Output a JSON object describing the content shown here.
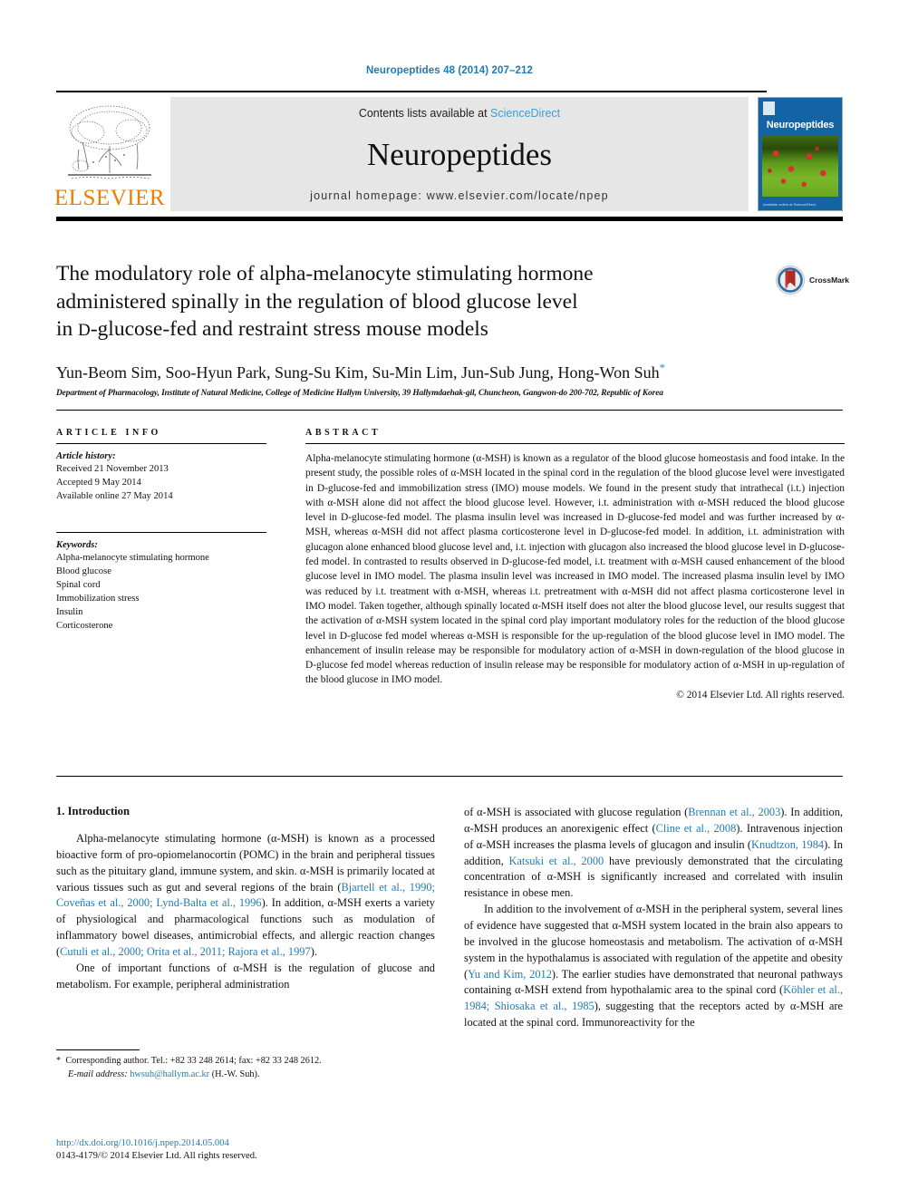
{
  "running_head": "Neuropeptides 48 (2014) 207–212",
  "masthead": {
    "contents_prefix": "Contents lists available at ",
    "sciencedirect": "ScienceDirect",
    "journal_name": "Neuropeptides",
    "homepage": "journal homepage: www.elsevier.com/locate/npep",
    "publisher_wordmark": "ELSEVIER",
    "cover_title": "Neuropeptides",
    "cover_footnote": "Available online at ScienceDirect"
  },
  "article": {
    "title_line1": "The modulatory role of alpha-melanocyte stimulating hormone",
    "title_line2": "administered spinally in the regulation of blood glucose level",
    "title_line3_a": "in ",
    "title_line3_smallcap": "D",
    "title_line3_b": "-glucose-fed and restraint stress mouse models",
    "authors": "Yun-Beom Sim, Soo-Hyun Park, Sung-Su Kim, Su-Min Lim, Jun-Sub Jung, Hong-Won Suh",
    "author_star": "*",
    "affiliation": "Department of Pharmacology, Institute of Natural Medicine, College of Medicine Hallym University, 39 Hallymdaehak-gil, Chuncheon, Gangwon-do 200-702, Republic of Korea",
    "crossmark_label": "CrossMark"
  },
  "article_info": {
    "heading": "ARTICLE INFO",
    "history_label": "Article history:",
    "history": [
      "Received 21 November 2013",
      "Accepted 9 May 2014",
      "Available online 27 May 2014"
    ],
    "keywords_label": "Keywords:",
    "keywords": [
      "Alpha-melanocyte stimulating hormone",
      "Blood glucose",
      "Spinal cord",
      "Immobilization stress",
      "Insulin",
      "Corticosterone"
    ]
  },
  "abstract": {
    "heading": "ABSTRACT",
    "text": "Alpha-melanocyte stimulating hormone (α-MSH) is known as a regulator of the blood glucose homeostasis and food intake. In the present study, the possible roles of α-MSH located in the spinal cord in the regulation of the blood glucose level were investigated in D-glucose-fed and immobilization stress (IMO) mouse models. We found in the present study that intrathecal (i.t.) injection with α-MSH alone did not affect the blood glucose level. However, i.t. administration with α-MSH reduced the blood glucose level in D-glucose-fed model. The plasma insulin level was increased in D-glucose-fed model and was further increased by α-MSH, whereas α-MSH did not affect plasma corticosterone level in D-glucose-fed model. In addition, i.t. administration with glucagon alone enhanced blood glucose level and, i.t. injection with glucagon also increased the blood glucose level in D-glucose-fed model. In contrasted to results observed in D-glucose-fed model, i.t. treatment with α-MSH caused enhancement of the blood glucose level in IMO model. The plasma insulin level was increased in IMO model. The increased plasma insulin level by IMO was reduced by i.t. treatment with α-MSH, whereas i.t. pretreatment with α-MSH did not affect plasma corticosterone level in IMO model. Taken together, although spinally located α-MSH itself does not alter the blood glucose level, our results suggest that the activation of α-MSH system located in the spinal cord play important modulatory roles for the reduction of the blood glucose level in D-glucose fed model whereas α-MSH is responsible for the up-regulation of the blood glucose level in IMO model. The enhancement of insulin release may be responsible for modulatory action of α-MSH in down-regulation of the blood glucose in D-glucose fed model whereas reduction of insulin release may be responsible for modulatory action of α-MSH in up-regulation of the blood glucose in IMO model.",
    "copyright": "© 2014 Elsevier Ltd. All rights reserved."
  },
  "introduction": {
    "heading": "1. Introduction",
    "left_p1_pre": "Alpha-melanocyte stimulating hormone (α-MSH) is known as a processed bioactive form of pro-opiomelanocortin (POMC) in the brain and peripheral tissues such as the pituitary gland, immune system, and skin. α-MSH is primarily located at various tissues such as gut and several regions of the brain (",
    "left_p1_cite1": "Bjartell et al., 1990; Coveñas et al., 2000; Lynd-Balta et al., 1996",
    "left_p1_mid": "). In addition, α-MSH exerts a variety of physiological and pharmacological functions such as modulation of inflammatory bowel diseases, antimicrobial effects, and allergic reaction changes (",
    "left_p1_cite2": "Cutuli et al., 2000; Orita et al., 2011; Rajora et al., 1997",
    "left_p1_post": ").",
    "left_p2": "One of important functions of α-MSH is the regulation of glucose and metabolism. For example, peripheral administration",
    "right_p1_pre": "of α-MSH is associated with glucose regulation (",
    "right_p1_cite1": "Brennan et al., 2003",
    "right_p1_mid1": "). In addition, α-MSH produces an anorexigenic effect (",
    "right_p1_cite2": "Cline et al., 2008",
    "right_p1_mid2": "). Intravenous injection of α-MSH increases the plasma levels of glucagon and insulin (",
    "right_p1_cite3": "Knudtzon, 1984",
    "right_p1_mid3": "). In addition, ",
    "right_p1_cite4": "Katsuki et al., 2000",
    "right_p1_post": " have previously demonstrated that the circulating concentration of α-MSH is significantly increased and correlated with insulin resistance in obese men.",
    "right_p2_pre": "In addition to the involvement of α-MSH in the peripheral system, several lines of evidence have suggested that α-MSH system located in the brain also appears to be involved in the glucose homeostasis and metabolism. The activation of α-MSH system in the hypothalamus is associated with regulation of the appetite and obesity (",
    "right_p2_cite1": "Yu and Kim, 2012",
    "right_p2_mid": "). The earlier studies have demonstrated that neuronal pathways containing α-MSH extend from hypothalamic area to the spinal cord (",
    "right_p2_cite2": "Köhler et al., 1984; Shiosaka et al., 1985",
    "right_p2_post": "), suggesting that the receptors acted by α-MSH are located at the spinal cord. Immunoreactivity for the"
  },
  "footnote": {
    "star": "*",
    "corresponding": "Corresponding author. Tel.: +82 33 248 2614; fax: +82 33 248 2612.",
    "email_label": "E-mail address:",
    "email": "hwsuh@hallym.ac.kr",
    "email_suffix": "(H.-W. Suh)."
  },
  "footer": {
    "doi": "http://dx.doi.org/10.1016/j.npep.2014.05.004",
    "issn": "0143-4179/© 2014 Elsevier Ltd. All rights reserved."
  },
  "colors": {
    "link": "#1f7bb6",
    "sciencedirect": "#3a9fd6",
    "elsevier_orange": "#f07c00",
    "cover_blue": "#1463a5"
  }
}
